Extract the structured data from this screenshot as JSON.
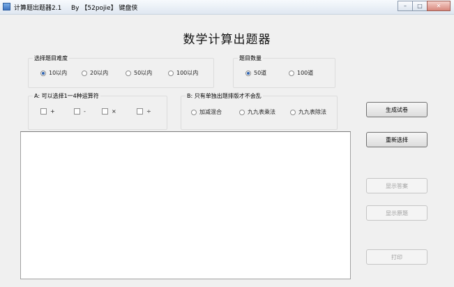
{
  "window": {
    "title": "计算题出题器2.1",
    "title_extra": "By 【52pojie】 键盘侠",
    "controls": {
      "minimize": "–",
      "maximize": "□",
      "close": "✕"
    }
  },
  "heading": "数学计算出题器",
  "difficulty": {
    "legend": "选择题目难度",
    "options": [
      {
        "label": "10以内",
        "checked": true
      },
      {
        "label": "20以内",
        "checked": false
      },
      {
        "label": "50以内",
        "checked": false
      },
      {
        "label": "100以内",
        "checked": false
      }
    ]
  },
  "count": {
    "legend": "题目数量",
    "options": [
      {
        "label": "50道",
        "checked": true
      },
      {
        "label": "100道",
        "checked": false
      }
    ]
  },
  "operators": {
    "legend": "A: 可以选择1一4种运算符",
    "options": [
      {
        "label": "+",
        "checked": false
      },
      {
        "label": "-",
        "checked": false
      },
      {
        "label": "×",
        "checked": false
      },
      {
        "label": "÷",
        "checked": false
      }
    ]
  },
  "single_mode": {
    "legend": "B: 只有单独出题排版才不会乱",
    "options": [
      {
        "label": "加减混合",
        "checked": false
      },
      {
        "label": "九九表乘法",
        "checked": false
      },
      {
        "label": "九九表除法",
        "checked": false
      }
    ]
  },
  "buttons": {
    "generate": "生成试卷",
    "reset": "重新选择",
    "show_answers": "显示答案",
    "show_questions": "显示原题",
    "print": "打印"
  }
}
